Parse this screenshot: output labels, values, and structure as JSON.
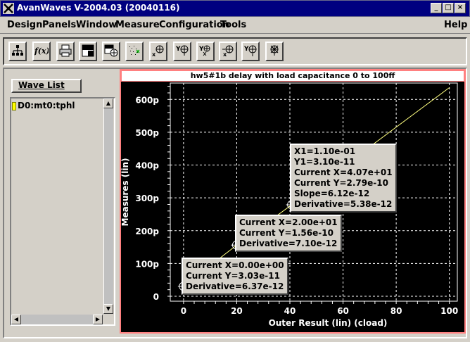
{
  "window": {
    "title": "AvanWaves V-2004.03 (20040116)",
    "minimize": "_",
    "maximize": "□",
    "close": "×"
  },
  "menu": {
    "items": [
      "Design",
      "Panels",
      "Window",
      "Measure",
      "Configuration",
      "Tools"
    ],
    "help": "Help"
  },
  "toolbar": {
    "buttons": [
      "hierarchy-icon",
      "function-icon",
      "print-icon",
      "panel-icon",
      "panel-add-icon",
      "scatter-icon",
      "cursor-x-icon",
      "cursor-y-icon",
      "measure-xy-icon",
      "cursor-x-add-icon",
      "cursor-y-add-icon",
      "delete-cursor-icon"
    ]
  },
  "wave_list": {
    "button_label": "Wave List",
    "items": [
      "D0:mt0:tphl"
    ],
    "marker_color": "#ffff00"
  },
  "plot": {
    "title": "hw5#1b delay with load capacitance 0 to 100ff",
    "trace_color": "#ffff80",
    "annotations": [
      {
        "lines": [
          "Current X=0.00e+00",
          "Current Y=3.03e-11",
          "Derivative=6.37e-12"
        ]
      },
      {
        "lines": [
          "Current X=2.00e+01",
          "Current Y=1.56e-10",
          "Derivative=7.10e-12"
        ]
      },
      {
        "lines": [
          "X1=1.10e-01",
          "Y1=3.10e-11",
          "Current X=4.07e+01",
          "Current Y=2.79e-10",
          "Slope=6.12e-12",
          "Derivative=5.38e-12"
        ]
      }
    ]
  },
  "chart_data": {
    "type": "line",
    "title": "hw5#1b delay with load capacitance 0 to 100ff",
    "xlabel": "Outer Result (lin) (cload)",
    "ylabel": "Measures (lin)",
    "xlim": [
      -5,
      103
    ],
    "ylim": [
      -15,
      650
    ],
    "x_ticks": [
      "0",
      "20",
      "40",
      "60",
      "80",
      "100"
    ],
    "x_tick_values": [
      0,
      20,
      40,
      60,
      80,
      100
    ],
    "y_ticks": [
      "0",
      "100p",
      "200p",
      "300p",
      "400p",
      "500p",
      "600p"
    ],
    "y_tick_values": [
      0,
      100,
      200,
      300,
      400,
      500,
      600
    ],
    "grid": true,
    "series": [
      {
        "name": "D0:mt0:tphl",
        "x": [
          0,
          20,
          40.7,
          100
        ],
        "y": [
          30.3,
          156,
          279,
          636
        ]
      }
    ],
    "markers": [
      {
        "x": 0,
        "y": 30.3
      },
      {
        "x": 20,
        "y": 156
      },
      {
        "x": 40.7,
        "y": 279
      }
    ]
  }
}
